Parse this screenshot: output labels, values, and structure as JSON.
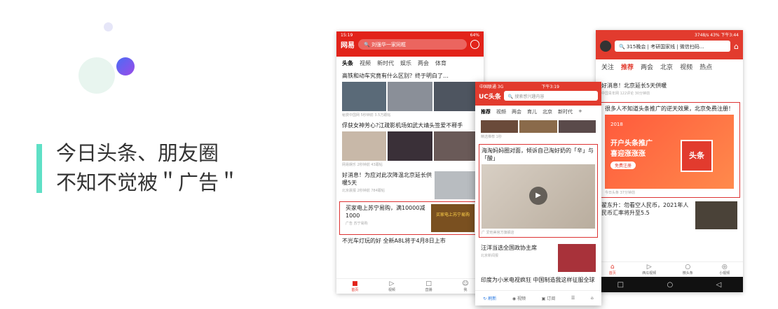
{
  "headline": {
    "line1": "今日头条、朋友圈",
    "line2": "不知不觉被＂广告＂"
  },
  "netease": {
    "status_time": "15:19",
    "status_right": "64%",
    "logo": "网易",
    "search": "刘强华一家同框",
    "tabs": [
      "头条",
      "视频",
      "新时代",
      "娱乐",
      "两会",
      "体育"
    ],
    "items": [
      {
        "title": "高铁和动车究竟有什么区别？终于明白了…",
        "meta": "秘费中国网 5秒钟前 3.5万跟帖"
      },
      {
        "title": "俘获女神芳心?江疏影机场如武大靖头签爱不释手",
        "meta": "网易娱乐 2秒钟前 43跟帖"
      },
      {
        "title": "好消息！为应对此次降温北京延长供暖5天",
        "meta": "北京晨报 2秒钟前 784跟帖"
      },
      {
        "title": "买家电上苏宁易购，满10000减1000",
        "meta": "广告 苏宁易购"
      },
      {
        "title": "不光车灯玩的好 全新A8L将于4月8日上市",
        "meta": ""
      }
    ],
    "ad_label": "买家电上苏宁易购",
    "nav": [
      "首页",
      "视频",
      "直播",
      "我"
    ]
  },
  "uc": {
    "status_left": "中国联通 3G",
    "status_time": "下午3:19",
    "logo": "UC头条",
    "search": "搜索感兴趣内容",
    "tabs": [
      "推荐",
      "视频",
      "两会",
      "育儿",
      "北京",
      "新时代"
    ],
    "items": [
      {
        "title": "",
        "meta": "精选推荐 1秒"
      },
      {
        "title": "海淘妈妈圈对面，倾诉自己淘好奶的「辛」与「酸」",
        "meta": "广 爱他美官方旗舰店"
      },
      {
        "title": "汪洋当选全国政协主席",
        "meta": "北京新闻报"
      },
      {
        "title": "印度为小米电视疯狂 中国制造我这样征服全球",
        "meta": ""
      }
    ],
    "nav": [
      "刷新",
      "视频",
      "订阅"
    ]
  },
  "toutiao": {
    "status_right": "3748/s 43% 下午3:44",
    "search": "315晚会 | 考研国家线 | 微信扫码...",
    "tabs": [
      "关注",
      "推荐",
      "两会",
      "北京",
      "视频",
      "热点"
    ],
    "items": [
      {
        "title": "好消息！北京延长5天供暖",
        "meta": "中国青年网 122评论 30分钟前"
      },
      {
        "title": "很多人不知道头条推广的逆天效果，北京免费注册！",
        "meta": "今日头条 37分钟前"
      },
      {
        "title": "翟东升：勿看空人民币，2021年人民币汇率将升至5.5",
        "meta": ""
      }
    ],
    "ad": {
      "year": "2018",
      "line1": "开户头条推广",
      "line2": "喜迎涨涨涨",
      "btn": "免费注册",
      "stamp": "头条"
    },
    "nav": [
      "首页",
      "西瓜视频",
      "微头条",
      "小视频"
    ]
  }
}
